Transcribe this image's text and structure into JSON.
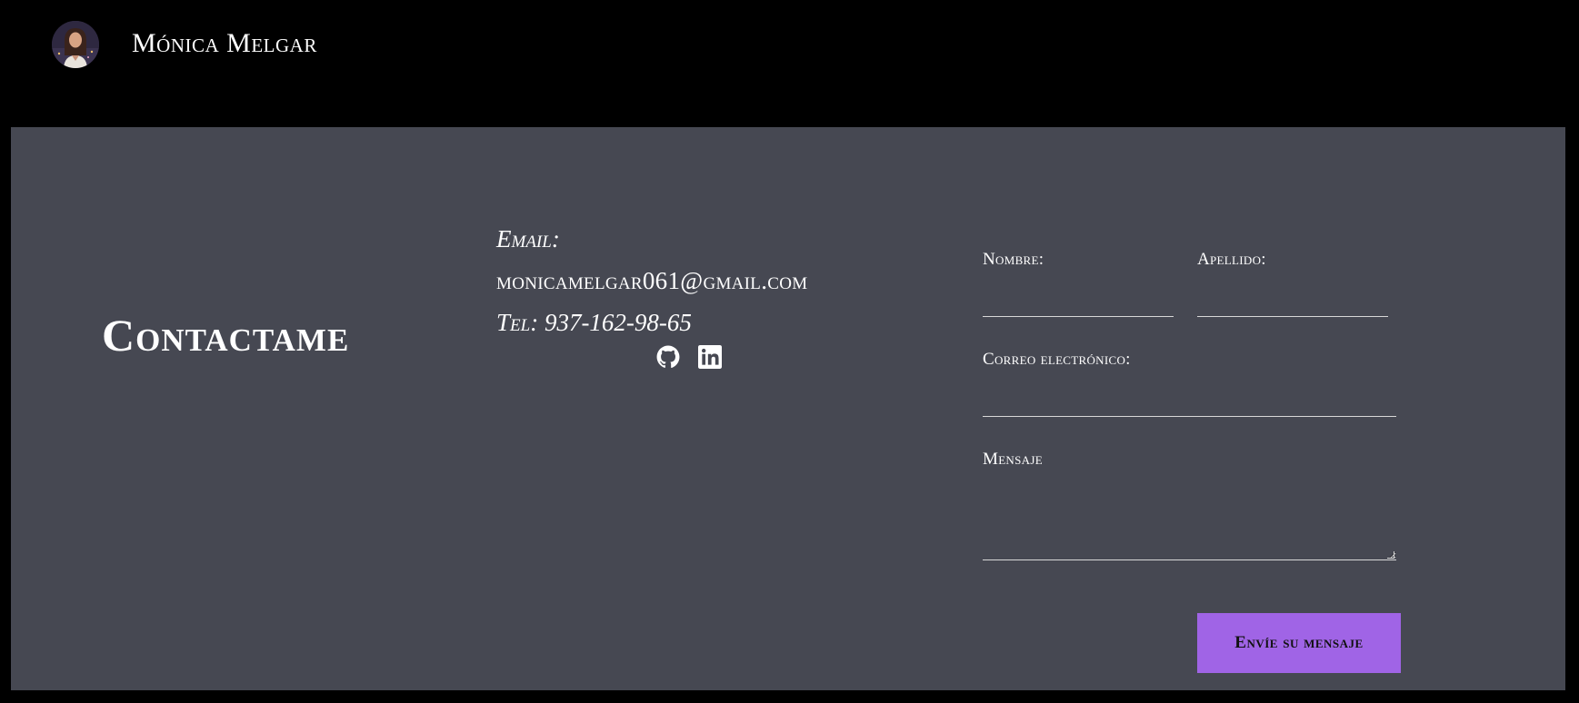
{
  "header": {
    "brand_name": "Mónica Melgar",
    "avatar_icon": "profile-photo-avatar"
  },
  "contact": {
    "title": "Contactame",
    "email_label": "Email:",
    "email_value": "monicamelgar061@gmail.com",
    "tel_label": "Tel:",
    "tel_value": "937-162-98-65",
    "socials": [
      {
        "name": "GitHub",
        "icon": "github-icon"
      },
      {
        "name": "LinkedIn",
        "icon": "linkedin-icon"
      }
    ]
  },
  "form": {
    "first_name_label": "Nombre:",
    "last_name_label": "Apellido:",
    "email_label": "Correo electrónico:",
    "message_label": "Mensaje",
    "first_name_value": "",
    "last_name_value": "",
    "email_value": "",
    "message_value": "",
    "submit_label": "Envíe su mensaje"
  },
  "colors": {
    "page_background": "#000000",
    "section_background": "#464852",
    "accent": "#a064e6",
    "text": "#ffffff"
  }
}
